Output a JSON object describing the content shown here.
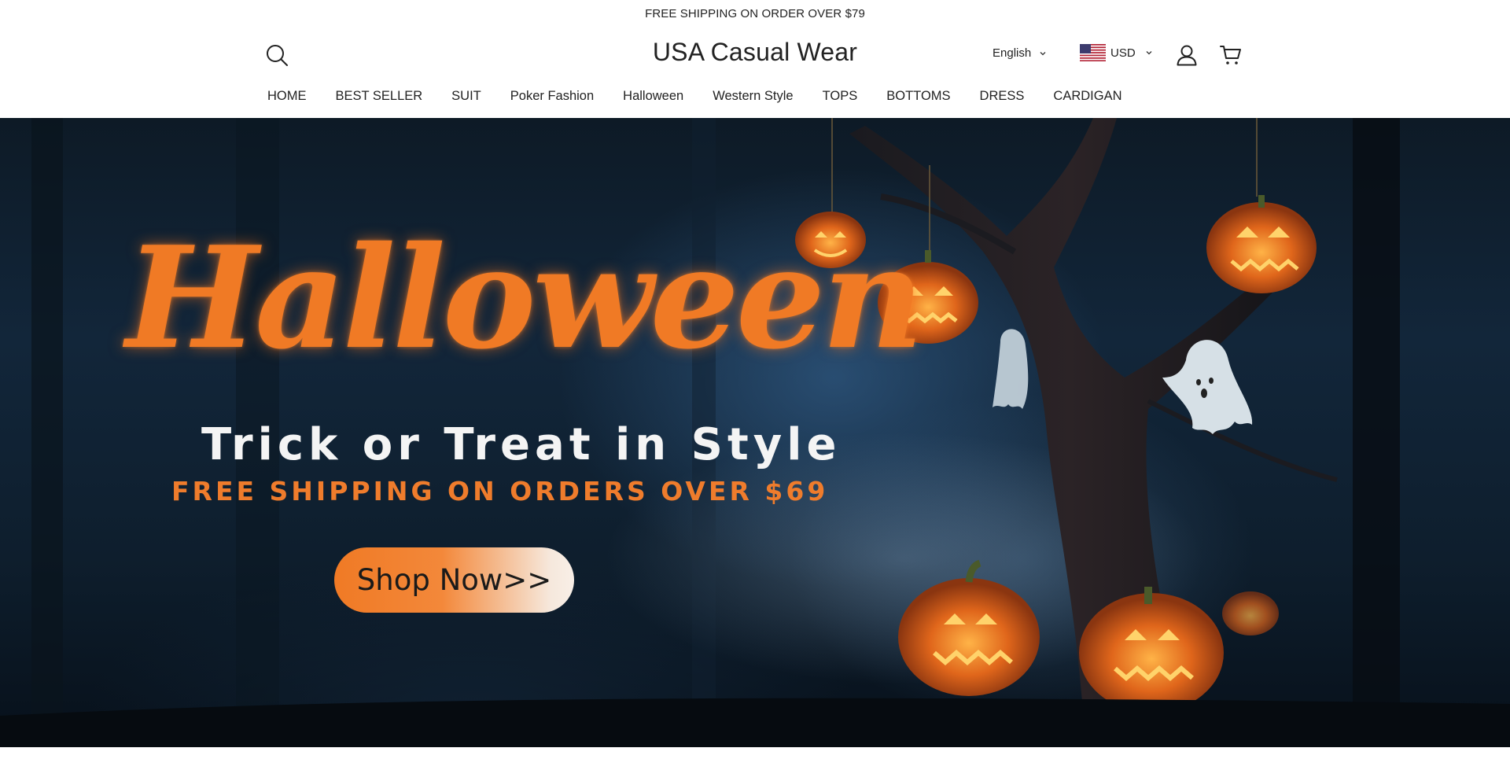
{
  "announcement": "FREE SHIPPING ON ORDER OVER $79",
  "header": {
    "logo": "USA Casual Wear",
    "language": "English",
    "currency": "USD",
    "icons": {
      "search": "search-icon",
      "account": "user-icon",
      "cart": "cart-icon",
      "flag": "us-flag-icon"
    }
  },
  "nav": {
    "glyph": "",
    "items": [
      {
        "label": "HOME",
        "has_glyph": false
      },
      {
        "label": "BEST SELLER",
        "has_glyph": true
      },
      {
        "label": "SUIT",
        "has_glyph": true
      },
      {
        "label": "Poker Fashion",
        "has_glyph": true
      },
      {
        "label": "Halloween",
        "has_glyph": true
      },
      {
        "label": "Western Style",
        "has_glyph": true
      },
      {
        "label": "TOPS",
        "has_glyph": true
      },
      {
        "label": "BOTTOMS",
        "has_glyph": true
      },
      {
        "label": "DRESS",
        "has_glyph": true
      },
      {
        "label": "CARDIGAN",
        "has_glyph": true
      }
    ]
  },
  "hero": {
    "title": "Halloween",
    "tagline": "Trick or Treat in Style",
    "promo": "FREE SHIPPING ON ORDERS OVER $69",
    "cta": "Shop Now>>"
  },
  "colors": {
    "accent_orange": "#f07a25",
    "hero_dark": "#0d1a26",
    "text": "#222222"
  }
}
